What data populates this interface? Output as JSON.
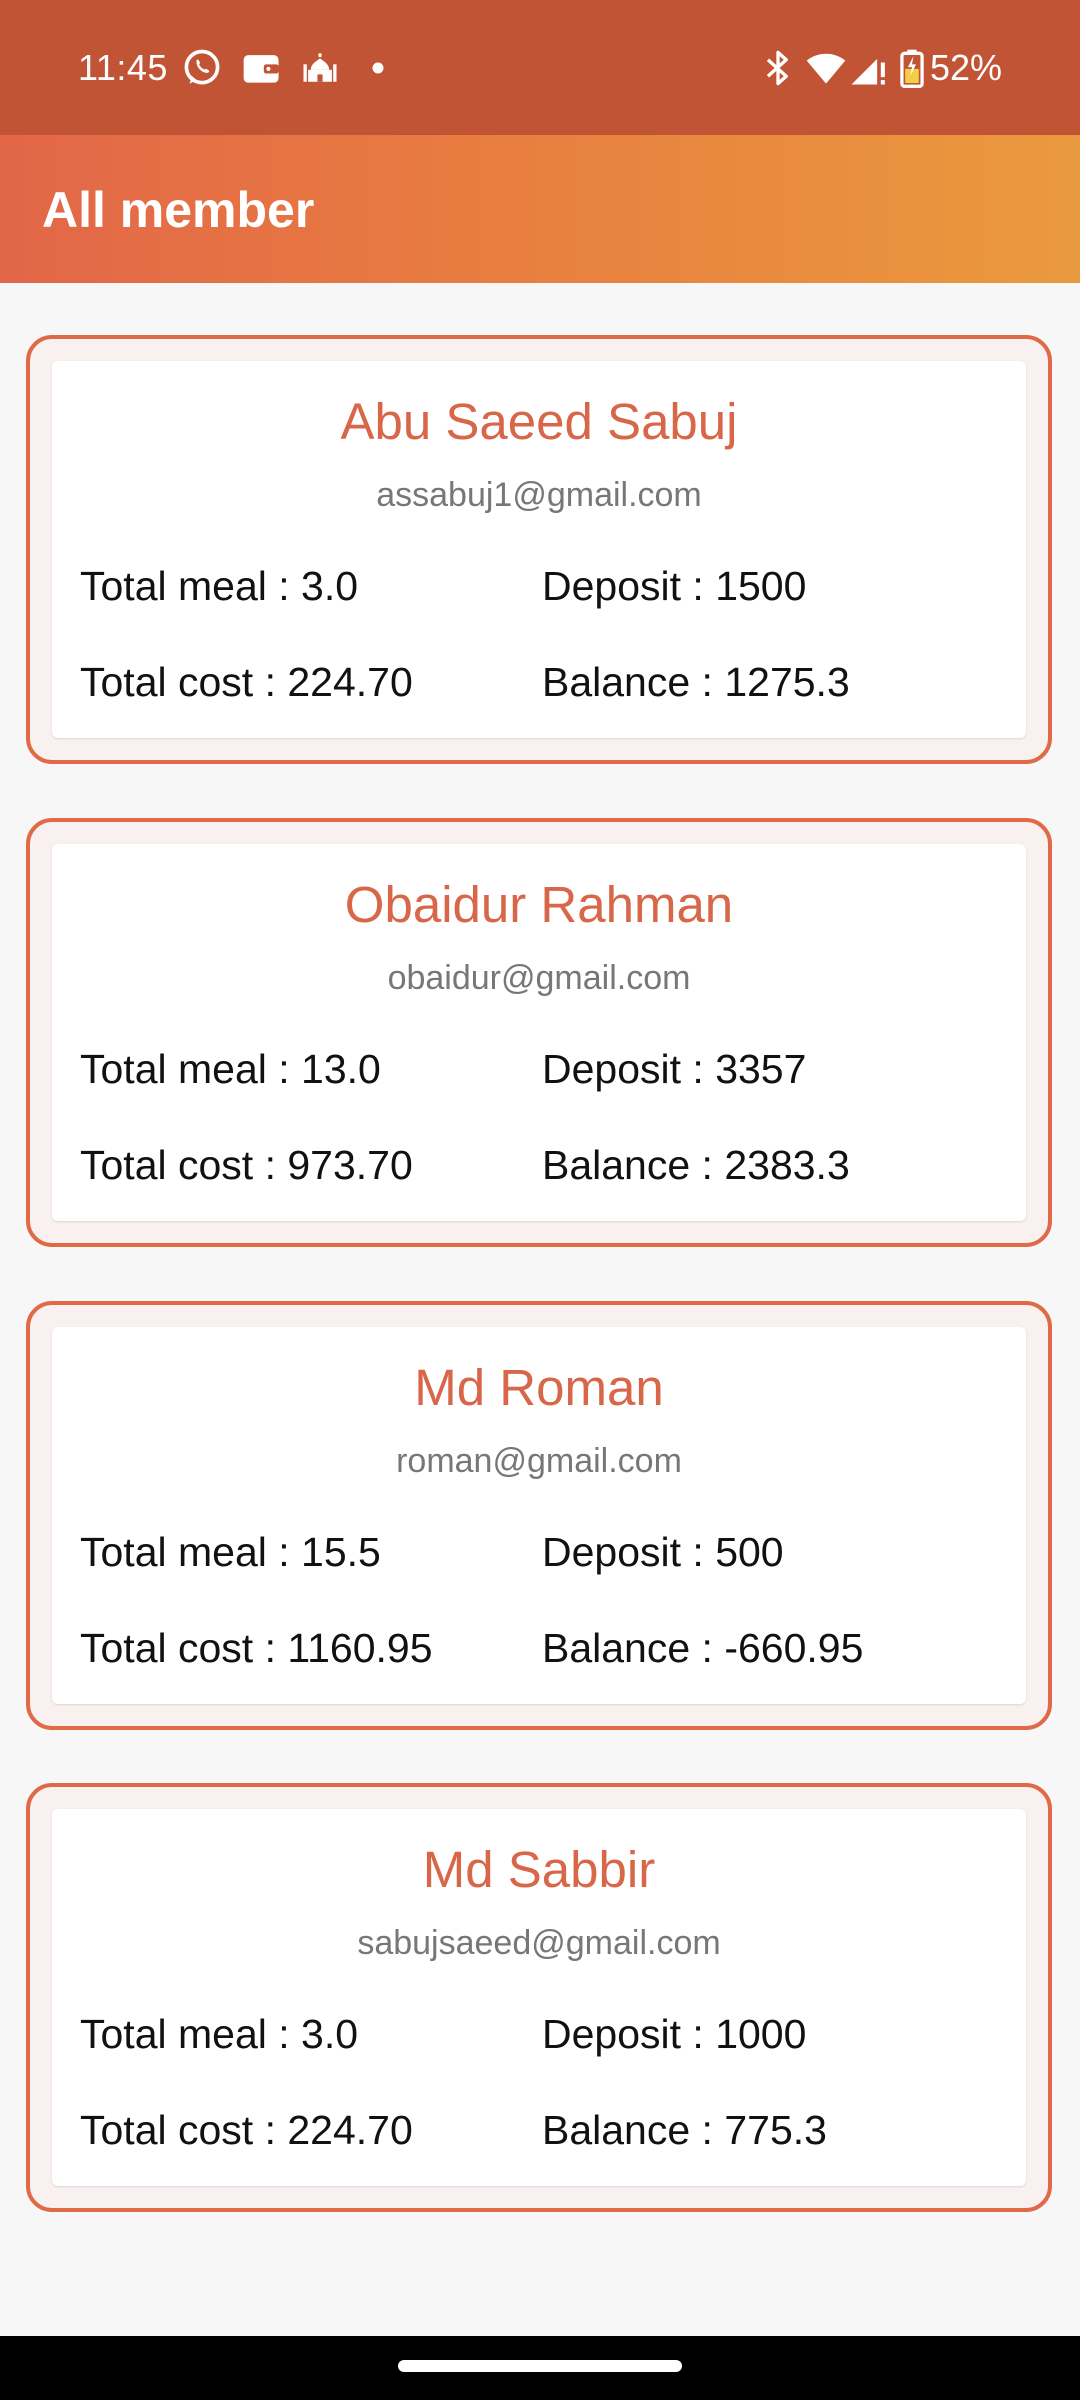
{
  "status_bar": {
    "time": "11:45",
    "battery": "52%",
    "icons_left": [
      "whatsapp-icon",
      "wallet-icon",
      "mosque-icon",
      "dot-icon"
    ],
    "icons_right": [
      "bluetooth-icon",
      "wifi-icon",
      "signal-icon",
      "battery-icon"
    ]
  },
  "app_bar": {
    "title": "All member"
  },
  "members": [
    {
      "name": "Abu Saeed Sabuj",
      "email": "assabuj1@gmail.com",
      "total_meal": "Total meal : 3.0",
      "deposit": "Deposit : 1500",
      "total_cost": "Total cost : 224.70",
      "balance": "Balance : 1275.3"
    },
    {
      "name": "Obaidur  Rahman",
      "email": "obaidur@gmail.com",
      "total_meal": "Total meal : 13.0",
      "deposit": "Deposit : 3357",
      "total_cost": "Total cost : 973.70",
      "balance": "Balance : 2383.3"
    },
    {
      "name": "Md Roman",
      "email": "roman@gmail.com",
      "total_meal": "Total meal : 15.5",
      "deposit": "Deposit : 500",
      "total_cost": "Total cost : 1160.95",
      "balance": "Balance : -660.95"
    },
    {
      "name": "Md Sabbir",
      "email": "sabujsaeed@gmail.com",
      "total_meal": "Total meal : 3.0",
      "deposit": "Deposit : 1000",
      "total_cost": "Total cost : 224.70",
      "balance": "Balance : 775.3"
    }
  ],
  "colors": {
    "status_bar": "#c25436",
    "app_bar_start": "#e26648",
    "app_bar_end": "#ea9a3e",
    "card_border": "#e06a47",
    "name_text": "#d8674a",
    "email_text": "#777777"
  }
}
